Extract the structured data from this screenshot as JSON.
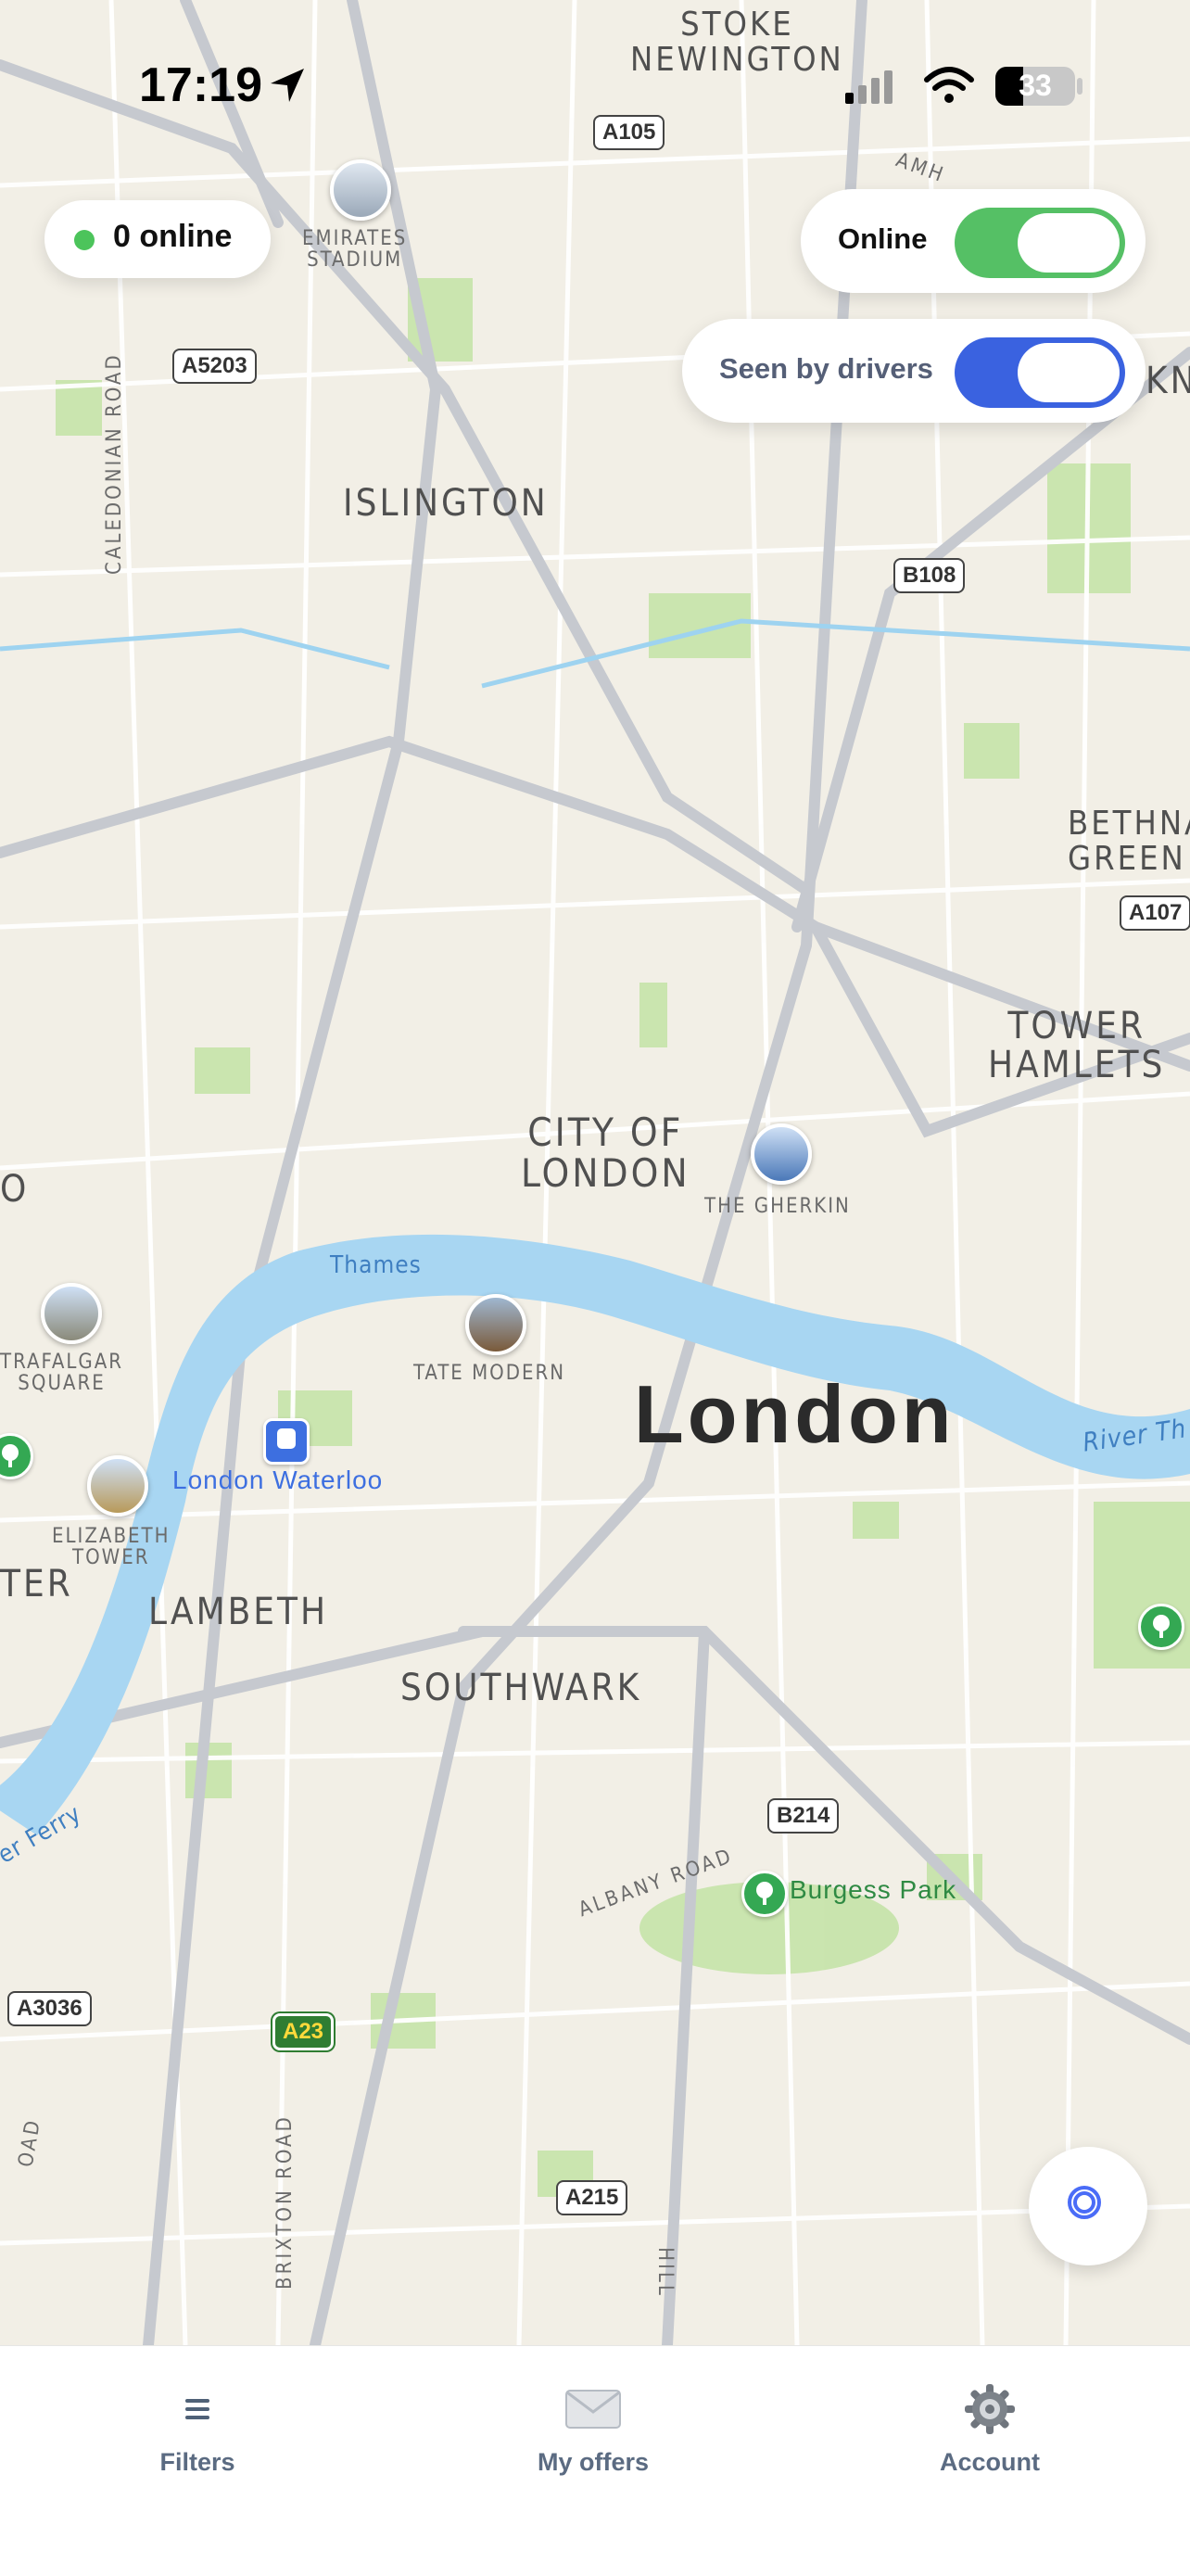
{
  "status_bar": {
    "time": "17:19",
    "battery": "33"
  },
  "overlay": {
    "online_count": "0 online",
    "online_toggle": {
      "label": "Online",
      "on": true,
      "color": "#55c065"
    },
    "seen_toggle": {
      "label": "Seen by drivers",
      "on": true,
      "color": "#3a62e0"
    }
  },
  "map": {
    "city_label": "London",
    "districts": {
      "stoke_newington": "STOKE\nNEWINGTON",
      "islington": "ISLINGTON",
      "city_of_london": "CITY OF\nLONDON",
      "tower_hamlets": "TOWER\nHAMLETS",
      "bethnal_green": "BETHNA\nGREEN",
      "lambeth": "LAMBETH",
      "southwark": "SOUTHWARK",
      "ter": "TER",
      "kn": "KN",
      "o": "O"
    },
    "pois": {
      "emirates": "EMIRATES\nSTADIUM",
      "gherkin": "THE GHERKIN",
      "tate": "TATE MODERN",
      "trafalgar": "TRAFALGAR\nSQUARE",
      "elizabeth": "ELIZABETH\nTOWER",
      "waterloo": "London Waterloo",
      "burgess": "Burgess Park"
    },
    "water": {
      "thames": "Thames",
      "river_thames": "River Th",
      "ferry": "er Ferry"
    },
    "streets": {
      "caledonian": "CALEDONIAN ROAD",
      "albany": "ALBANY ROAD",
      "brixton": "BRIXTON ROAD",
      "amh": "AMH",
      "hill": "HILL",
      "oad": "OAD"
    },
    "road_signs": {
      "a105": "A105",
      "a5203": "A5203",
      "b108": "B108",
      "a107": "A107",
      "b214": "B214",
      "a3036": "A3036",
      "a23": "A23",
      "a215": "A215"
    }
  },
  "tabs": [
    {
      "label": "Filters",
      "icon": "filter-lines-icon"
    },
    {
      "label": "My offers",
      "icon": "envelope-icon"
    },
    {
      "label": "Account",
      "icon": "gear-icon"
    }
  ]
}
